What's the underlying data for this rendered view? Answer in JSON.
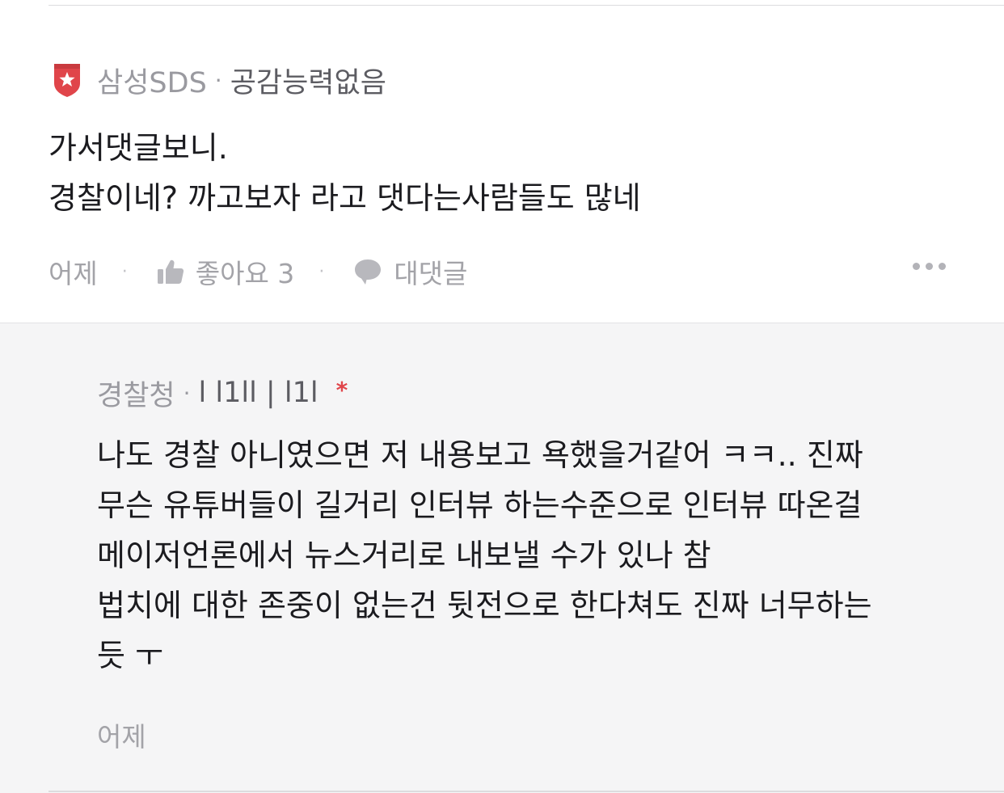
{
  "comment": {
    "author_company": "삼성SDS",
    "author_separator": "·",
    "author_nickname": "공감능력없음",
    "body_lines": [
      "가서댓글보니.",
      "경찰이네? 까고보자 라고 댓다는사람들도 많네"
    ],
    "time": "어제",
    "like_label": "좋아요 3",
    "reply_label": "대댓글",
    "action_separator": "·",
    "icons": {
      "company_logo": "shield-star-icon",
      "like": "thumbs-up-icon",
      "reply": "speech-bubble-icon",
      "more": "more-dots-icon"
    },
    "colors": {
      "logo_red": "#e0454a"
    }
  },
  "reply": {
    "author_org": "경찰청",
    "author_separator": "·",
    "author_nickname": "l l1ll | l1l",
    "writer_mark": "*",
    "body_lines": [
      "나도 경찰 아니였으면 저 내용보고 욕했을거같어 ㅋㅋ.. 진짜",
      "무슨 유튜버들이 길거리 인터뷰 하는수준으로 인터뷰 따온걸",
      "메이저언론에서 뉴스거리로 내보낼 수가 있나 참",
      "법치에 대한 존중이 없는건 뒷전으로 한다쳐도 진짜 너무하는",
      "듯 ㅜ"
    ],
    "time": "어제",
    "colors": {
      "writer_mark": "#e0454a",
      "background": "#f5f5f6"
    }
  }
}
